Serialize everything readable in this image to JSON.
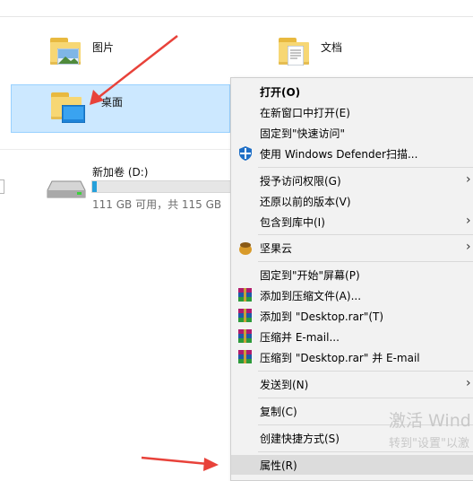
{
  "explorer": {
    "folder_pictures": "图片",
    "folder_documents": "文档",
    "folder_desktop": "桌面",
    "drive": {
      "name": "新加卷 (D:)",
      "usage_text": "111 GB 可用，共 115 GB",
      "used_fraction": 0.035,
      "bar_color": "#26a0da"
    }
  },
  "context_menu": {
    "items": [
      {
        "label": "打开(O)"
      },
      {
        "label": "在新窗口中打开(E)"
      },
      {
        "label": "固定到\"快速访问\""
      },
      {
        "label": "使用 Windows Defender扫描..."
      },
      {
        "label": "授予访问权限(G)"
      },
      {
        "label": "还原以前的版本(V)"
      },
      {
        "label": "包含到库中(I)"
      },
      {
        "label": "坚果云"
      },
      {
        "label": "固定到\"开始\"屏幕(P)"
      },
      {
        "label": "添加到压缩文件(A)..."
      },
      {
        "label": "添加到 \"Desktop.rar\"(T)"
      },
      {
        "label": "压缩并 E-mail..."
      },
      {
        "label": "压缩到 \"Desktop.rar\" 并 E-mail"
      },
      {
        "label": "发送到(N)"
      },
      {
        "label": "复制(C)"
      },
      {
        "label": "创建快捷方式(S)"
      },
      {
        "label": "属性(R)"
      }
    ]
  },
  "watermark": {
    "line1": "激活 Wind",
    "line2": "转到\"设置\"以激"
  },
  "colors": {
    "annotation_arrow": "#e8423a",
    "selection_bg": "#cce8ff",
    "menu_bg": "#f2f2f2"
  }
}
